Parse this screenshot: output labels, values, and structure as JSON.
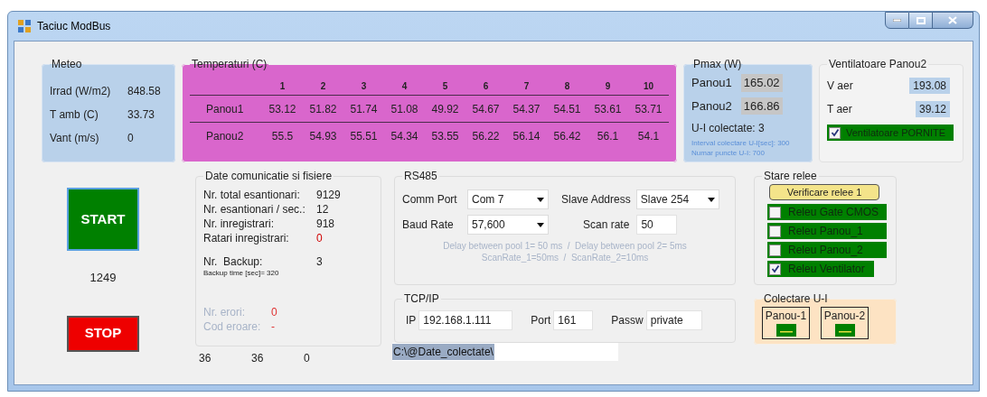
{
  "window": {
    "title": "Taciuc ModBus"
  },
  "meteo": {
    "title": "Meteo",
    "rows": [
      {
        "label": "Irrad (W/m2)",
        "value": "848.58"
      },
      {
        "label": "T amb (C)",
        "value": "33.73"
      },
      {
        "label": "Vant (m/s)",
        "value": "0"
      }
    ]
  },
  "temperaturi": {
    "title": "Temperaturi (C)",
    "columns": [
      "1",
      "2",
      "3",
      "4",
      "5",
      "6",
      "7",
      "8",
      "9",
      "10"
    ],
    "rows": [
      {
        "label": "Panou1",
        "values": [
          "53.12",
          "51.82",
          "51.74",
          "51.08",
          "49.92",
          "54.67",
          "54.37",
          "54.51",
          "53.61",
          "53.71"
        ]
      },
      {
        "label": "Panou2",
        "values": [
          "55.5",
          "54.93",
          "55.51",
          "54.34",
          "53.55",
          "56.22",
          "56.14",
          "56.42",
          "56.1",
          "54.1"
        ]
      }
    ]
  },
  "pmax": {
    "title": "Pmax (W)",
    "rows": [
      {
        "label": "Panou1",
        "value": "165.02"
      },
      {
        "label": "Panou2",
        "value": "166.86"
      }
    ],
    "ui_colectate": "U-I colectate: 3",
    "notes": [
      "Interval colectare U-I[sec]: 300",
      "Numar puncte U-I: 700"
    ]
  },
  "ventilatoare": {
    "title": "Ventilatoare Panou2",
    "rows": [
      {
        "label": "V aer",
        "value": "193.08"
      },
      {
        "label": "T aer",
        "value": "39.12"
      }
    ],
    "status": {
      "label": "Ventilatoare PORNITE",
      "checked": true
    }
  },
  "start_button": "START",
  "counter": "1249",
  "stop_button": "STOP",
  "date_comunicatie": {
    "title": "Date comunicatie si fisiere",
    "rows": [
      {
        "label": "Nr. total esantionari:",
        "value": "9129",
        "kind": "normal"
      },
      {
        "label": "Nr. esantionari / sec.:",
        "value": "12",
        "kind": "normal"
      },
      {
        "label": "Nr. inregistrari:",
        "value": "918",
        "kind": "normal"
      },
      {
        "label": "Ratari inregistrari:",
        "value": "0",
        "kind": "alert"
      }
    ],
    "backup": {
      "label": "Nr.  Backup:",
      "value": "3",
      "note": "Backup time [sec]= 320"
    },
    "errors": [
      {
        "label": "Nr. erori:",
        "value": "0"
      },
      {
        "label": "Cod eroare:",
        "value": "-"
      }
    ]
  },
  "footer_counts": [
    "36",
    "36",
    "0"
  ],
  "rs485": {
    "title": "RS485",
    "comm_port": {
      "label": "Comm Port",
      "value": "Com 7"
    },
    "slave_address": {
      "label": "Slave Address",
      "value": "Slave 254"
    },
    "baud_rate": {
      "label": "Baud Rate",
      "value": "57,600"
    },
    "scan_rate": {
      "label": "Scan rate",
      "value": "50"
    },
    "notes": [
      "Delay between pool 1= 50 ms  /  Delay between pool 2= 5ms",
      "ScanRate_1=50ms  /  ScanRate_2=10ms"
    ]
  },
  "tcpip": {
    "title": "TCP/IP",
    "fields": [
      {
        "label": "IP",
        "value": "192.168.1.111"
      },
      {
        "label": "Port",
        "value": "161"
      },
      {
        "label": "Passw",
        "value": "private"
      }
    ]
  },
  "path": {
    "value": "C:\\@Date_colectate\\"
  },
  "stare_relee": {
    "title": "Stare relee",
    "button": "Verificare relee 1",
    "relays": [
      {
        "label": "Releu Gate CMOS",
        "checked": false
      },
      {
        "label": "Releu Panou_1",
        "checked": false
      },
      {
        "label": "Releu Panou_2",
        "checked": false
      },
      {
        "label": "Releu Ventilator",
        "checked": true
      }
    ]
  },
  "colectare": {
    "title": "Colectare U-I",
    "panels": [
      {
        "label": "Panou-1"
      },
      {
        "label": "Panou-2"
      }
    ]
  }
}
